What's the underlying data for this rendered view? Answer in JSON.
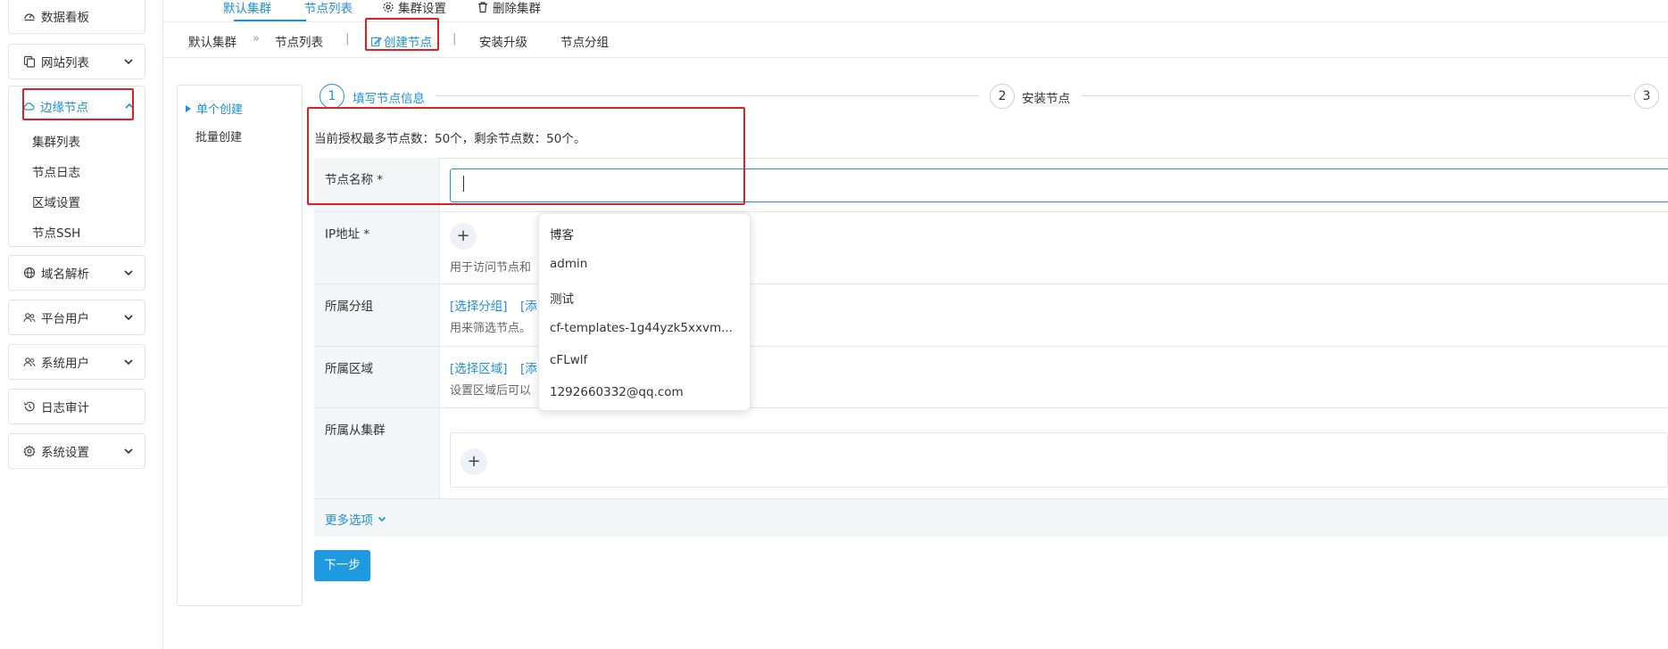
{
  "sidebar": {
    "items": [
      {
        "label": "数据看板",
        "icon": "dashboard-icon"
      },
      {
        "label": "网站列表",
        "icon": "copy-icon"
      },
      {
        "label": "边缘节点",
        "icon": "cloud-icon"
      },
      {
        "label": "域名解析",
        "icon": "globe-icon"
      },
      {
        "label": "平台用户",
        "icon": "users-icon"
      },
      {
        "label": "系统用户",
        "icon": "users-icon"
      },
      {
        "label": "日志审计",
        "icon": "history-icon"
      },
      {
        "label": "系统设置",
        "icon": "gear-icon"
      }
    ],
    "sub_items": [
      "集群列表",
      "节点日志",
      "区域设置",
      "节点SSH"
    ]
  },
  "top_tabs": [
    "默认集群",
    "节点列表",
    "集群设置",
    "删除集群"
  ],
  "sub_nav": {
    "cluster": "默认集群",
    "arrow": "»",
    "node_list": "节点列表",
    "sep": "|",
    "create_node": "创建节点",
    "upgrade": "安装升级",
    "groups": "节点分组"
  },
  "create_modes": {
    "single": "单个创建",
    "batch": "批量创建"
  },
  "steps": [
    {
      "num": "1",
      "label": "填写节点信息"
    },
    {
      "num": "2",
      "label": "安装节点"
    },
    {
      "num": "3",
      "label": ""
    }
  ],
  "quota_text": "当前授权最多节点数：50个，剩余节点数：50个。",
  "form": {
    "name_label": "节点名称 *",
    "name_value": "",
    "ip_label": "IP地址 *",
    "ip_hint": "用于访问节点和",
    "group_label": "所属分组",
    "group_select": "[选择分组]",
    "group_add": "[添",
    "group_hint": "用来筛选节点。",
    "region_label": "所属区域",
    "region_select": "[选择区域]",
    "region_add": "[添",
    "region_hint": "设置区域后可以",
    "sub_cluster_label": "所属从集群",
    "plus": "+"
  },
  "more_options": "更多选项",
  "next_button": "下一步",
  "autocomplete": [
    "博客",
    "admin",
    "测试",
    "cf-templates-1g44yzk5xxvm...",
    "cFLwlf",
    "1292660332@qq.com"
  ],
  "colors": {
    "accent": "#1e90d8",
    "highlight_box": "#e02020",
    "button": "#1e9be0"
  }
}
